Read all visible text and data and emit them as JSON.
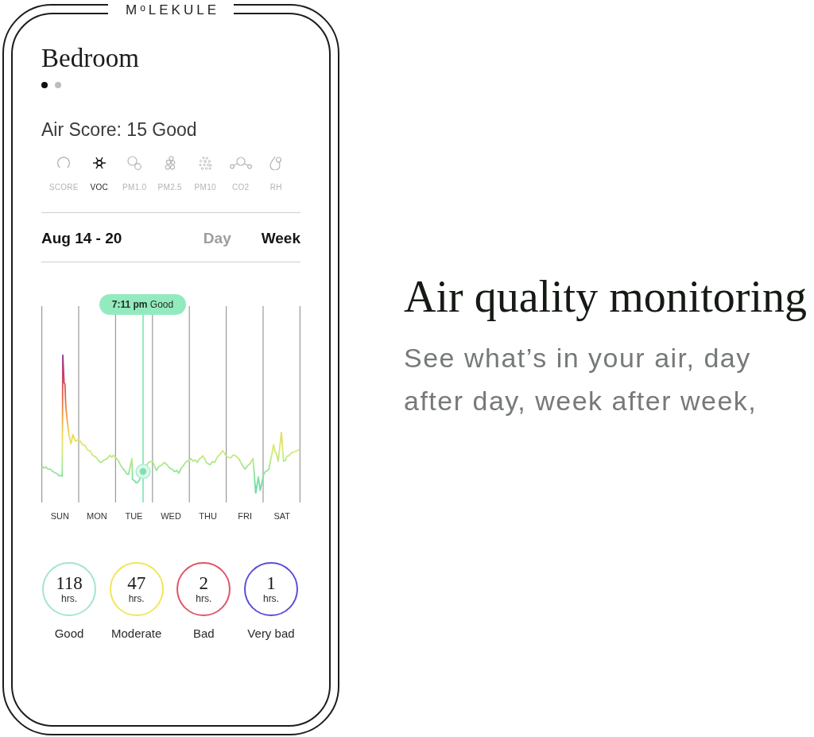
{
  "logo": "M$^{o}$LEKULE",
  "room": {
    "title": "Bedroom",
    "pages": [
      {
        "selected": true
      },
      {
        "selected": false
      }
    ]
  },
  "air_score": "Air Score: 15 Good",
  "metrics": [
    {
      "label": "SCORE",
      "selected": false
    },
    {
      "label": "VOC",
      "selected": true
    },
    {
      "label": "PM1.0",
      "selected": false
    },
    {
      "label": "PM2.5",
      "selected": false
    },
    {
      "label": "PM10",
      "selected": false
    },
    {
      "label": "CO2",
      "selected": false
    },
    {
      "label": "RH",
      "selected": false
    }
  ],
  "period": {
    "range": "Aug 14 - 20",
    "tabs": [
      {
        "label": "Day",
        "selected": false
      },
      {
        "label": "Week",
        "selected": true
      }
    ]
  },
  "chart": {
    "tooltip": "**7:11 pm** Good",
    "days": [
      "SUN",
      "MON",
      "TUE",
      "WED",
      "THU",
      "FRI",
      "SAT"
    ]
  },
  "summary": [
    {
      "value": "118",
      "unit": "hrs.",
      "label": "Good",
      "color": "#a3e4d0"
    },
    {
      "value": "47",
      "unit": "hrs.",
      "label": "Moderate",
      "color": "#f1e65a"
    },
    {
      "value": "2",
      "unit": "hrs.",
      "label": "Bad",
      "color": "#e05467"
    },
    {
      "value": "1",
      "unit": "hrs.",
      "label": "Very bad",
      "color": "#5b4fd6"
    }
  ],
  "feature": {
    "heading": "Air quality monitoring",
    "description": "See what’s in your air, day after day, week after week,"
  }
}
